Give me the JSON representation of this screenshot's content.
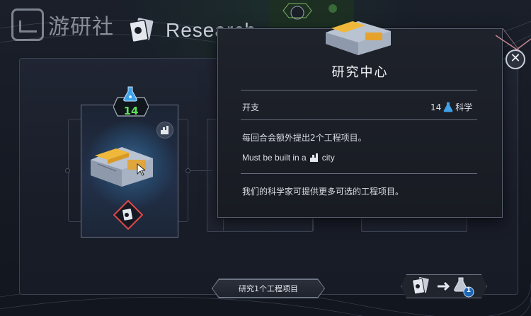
{
  "watermark": {
    "text": "游研社"
  },
  "screen": {
    "title": "Research"
  },
  "tooltip": {
    "title": "研究中心",
    "cost_label": "开支",
    "cost_value": "14",
    "cost_unit": "科学",
    "effect": "每回合会额外提出2个工程项目。",
    "requirement_prefix": "Must be built in a",
    "requirement_suffix": "city",
    "flavor": "我们的科学家可提供更多可选的工程项目。"
  },
  "card": {
    "cost": "14"
  },
  "research_button": {
    "label": "研究1个工程项目"
  },
  "exchange": {
    "badge": "1"
  },
  "colors": {
    "accent_green": "#5ee05a",
    "science_blue": "#3fa2e8",
    "panel_bg": "#1e222b",
    "border": "#5a6272"
  },
  "icons": [
    "science-flask-icon",
    "city-icon",
    "close-icon",
    "project-card-icon",
    "arrow-right-icon",
    "research-building-icon",
    "cursor-icon"
  ]
}
